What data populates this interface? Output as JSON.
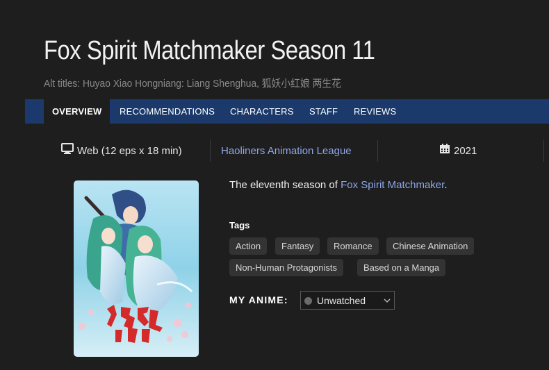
{
  "page": {
    "title": "Fox Spirit Matchmaker Season 11",
    "alt_titles": "Alt titles: Huyao Xiao Hongniang: Liang Shenghua, 狐妖小红娘 两生花"
  },
  "tabs": [
    {
      "label": "OVERVIEW",
      "active": true
    },
    {
      "label": "RECOMMENDATIONS"
    },
    {
      "label": "CHARACTERS"
    },
    {
      "label": "STAFF"
    },
    {
      "label": "REVIEWS"
    }
  ],
  "meta": {
    "format_icon": "monitor-icon",
    "format": "Web (12 eps x 18 min)",
    "studio": "Haoliners Animation League",
    "year_icon": "calendar-icon",
    "year": "2021"
  },
  "cover": {
    "logo_text": "狐妖小红娘"
  },
  "description": {
    "prefix": "The eleventh season of ",
    "link": "Fox Spirit Matchmaker",
    "suffix": "."
  },
  "tags_heading": "Tags",
  "tags": [
    "Action",
    "Fantasy",
    "Romance",
    "Chinese Animation",
    "Non-Human Protagonists",
    "Based on a Manga"
  ],
  "my_anime": {
    "label": "MY ANIME:",
    "status": "Unwatched",
    "status_color": "#6b6b6b"
  },
  "colors": {
    "background": "#1e1e1e",
    "tabbar": "#1b3a6b",
    "link": "#8ea7ea"
  }
}
